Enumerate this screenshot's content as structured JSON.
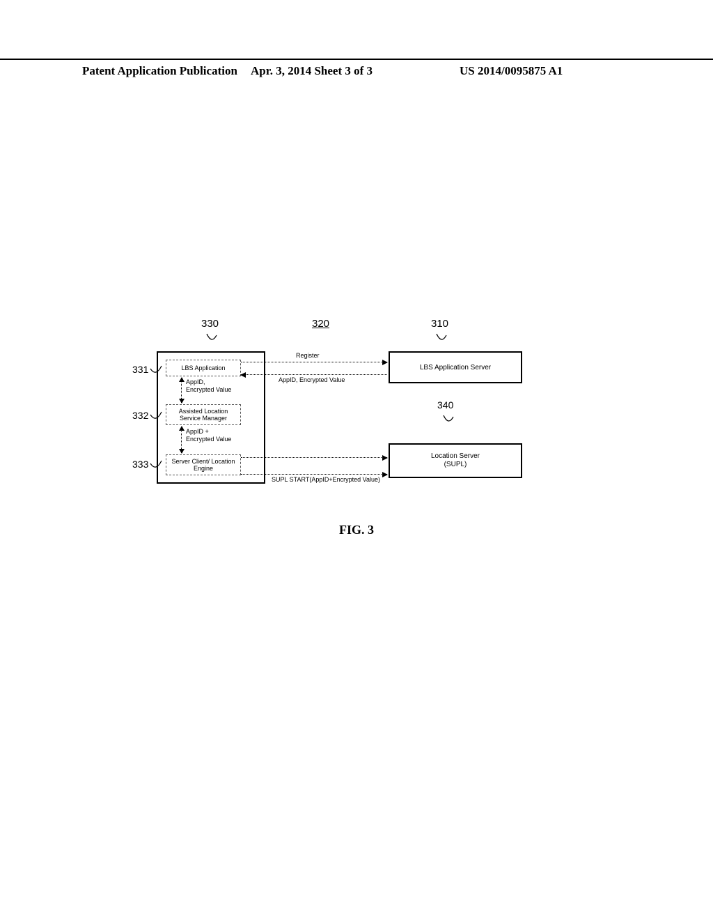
{
  "header": {
    "left": "Patent Application Publication",
    "mid": "Apr. 3, 2014  Sheet 3 of 3",
    "right": "US 2014/0095875 A1"
  },
  "refs": {
    "r330": "330",
    "r320": "320",
    "r310": "310",
    "r331": "331",
    "r332": "332",
    "r333": "333",
    "r340": "340"
  },
  "boxes": {
    "lbs_app": "LBS Application",
    "alsm": "Assisted Location Service Manager",
    "scle": "Server Client/ Location Engine",
    "lbs_server": "LBS Application Server",
    "loc_server_line1": "Location Server",
    "loc_server_line2": "(SUPL)"
  },
  "messages": {
    "register": "Register",
    "appid_enc": "AppID, Encrypted Value",
    "supl_start": "SUPL START(AppID+Encrypted Value)",
    "v1_line1": "AppID,",
    "v1_line2": "Encrypted Value",
    "v2_line1": "AppID +",
    "v2_line2": "Encrypted Value"
  },
  "caption": "FIG. 3"
}
